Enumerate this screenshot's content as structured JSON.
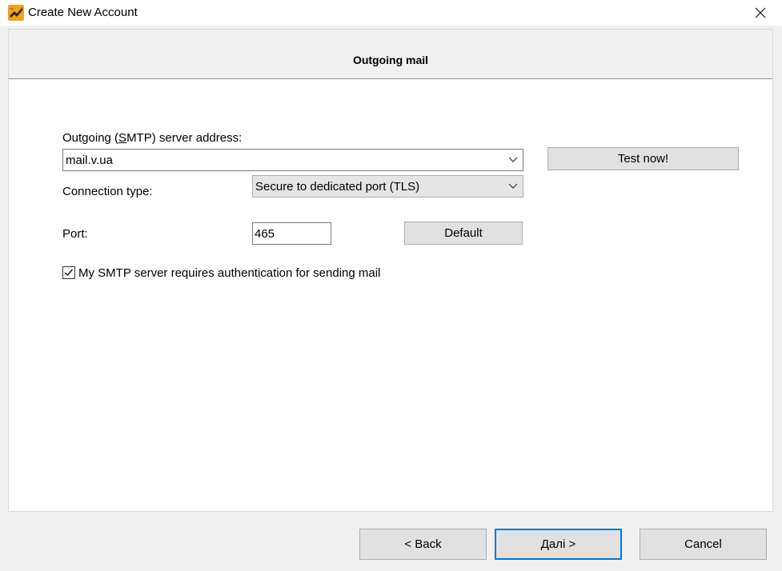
{
  "window": {
    "title": "Create New Account"
  },
  "header": {
    "title": "Outgoing mail"
  },
  "smtp": {
    "label_before": "Outgoing (",
    "label_mnemonic": "S",
    "label_after": "MTP) server address:",
    "value": "mail.v.ua"
  },
  "test_button": "Test now!",
  "connection": {
    "label": "Connection type:",
    "value": "Secure to dedicated port (TLS)"
  },
  "port": {
    "label": "Port:",
    "value": "465",
    "default_button": "Default"
  },
  "auth": {
    "label": "My SMTP server requires authentication for sending mail",
    "checked": true
  },
  "footer": {
    "back": "<  Back",
    "next": "Далі    >",
    "cancel": "Cancel"
  }
}
